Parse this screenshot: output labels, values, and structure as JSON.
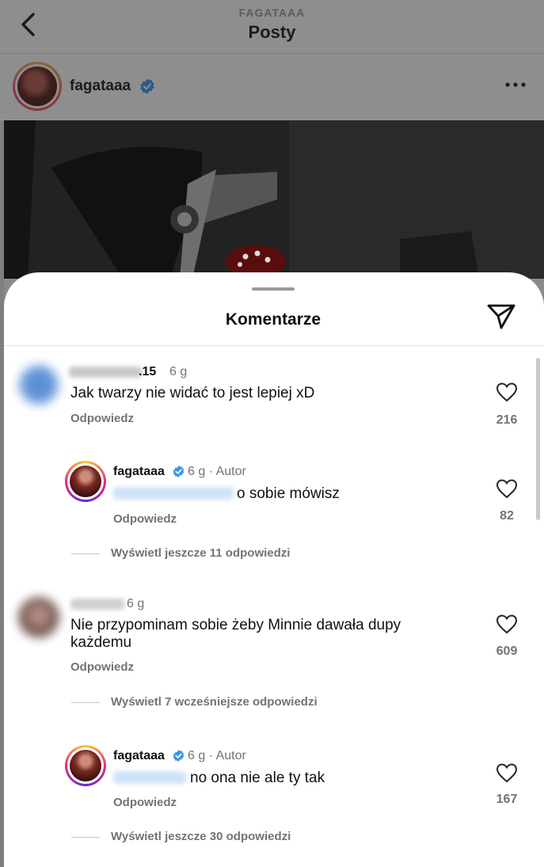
{
  "header": {
    "subtitle": "FAGATAAA",
    "title": "Posty"
  },
  "post": {
    "username": "fagataaa"
  },
  "sheet": {
    "title": "Komentarze"
  },
  "comments": [
    {
      "username_visible": ".15",
      "time": "6 g",
      "text": "Jak twarzy nie widać to jest lepiej xD",
      "reply_label": "Odpowiedz",
      "likes": "216"
    },
    {
      "username": "fagataaa",
      "meta": "6 g · Autor",
      "text": "o sobie mówisz",
      "reply_label": "Odpowiedz",
      "likes": "82",
      "thread_link": "Wyświetl jeszcze 11 odpowiedzi"
    },
    {
      "time": "6 g",
      "text_line1": "Nie przypominam sobie żeby Minnie dawała dupy",
      "text_line2": "każdemu",
      "reply_label": "Odpowiedz",
      "likes": "609",
      "thread_link": "Wyświetl 7 wcześniejsze odpowiedzi"
    },
    {
      "username": "fagataaa",
      "meta": "6 g · Autor",
      "text": "no ona nie ale ty tak",
      "reply_label": "Odpowiedz",
      "likes": "167",
      "thread_link": "Wyświetl jeszcze 30 odpowiedzi"
    }
  ],
  "colors": {
    "verified": "#3897f0",
    "secondary_text": "#737373",
    "overlay": "#8a8a8a"
  },
  "icons": [
    "back-icon",
    "verified-icon",
    "more-icon",
    "send-icon",
    "heart-icon"
  ]
}
